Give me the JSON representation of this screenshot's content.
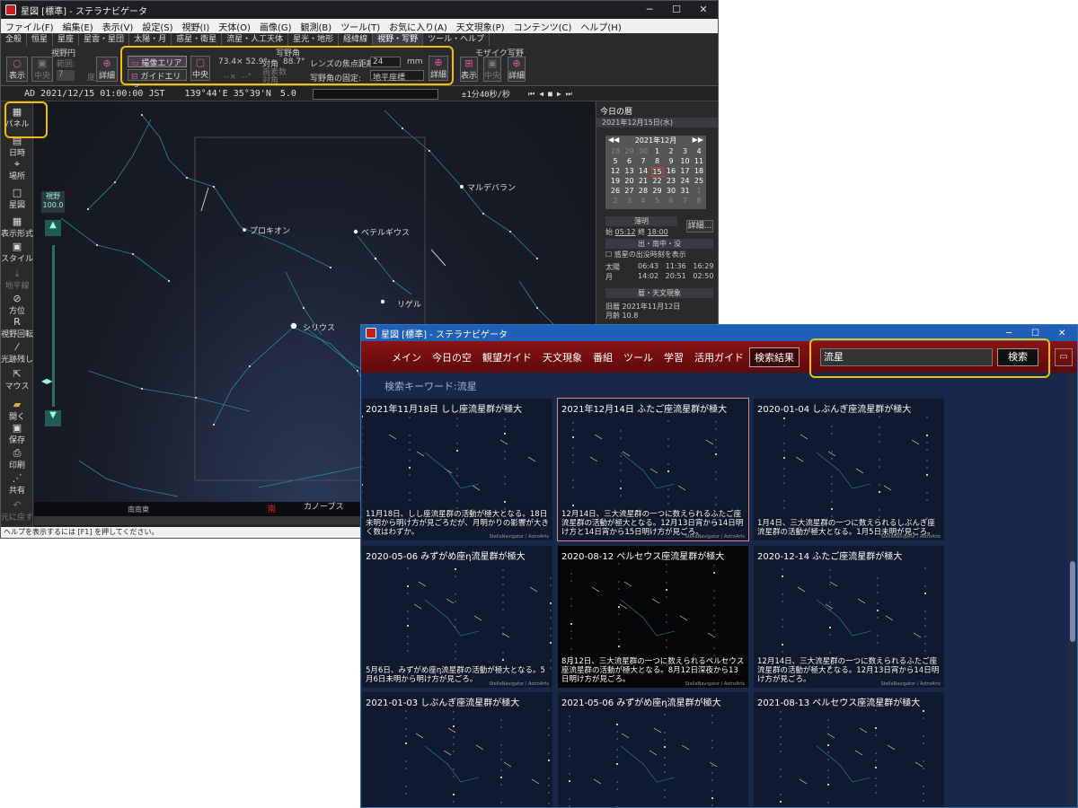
{
  "main": {
    "title": "星図 [標準] - ステラナビゲータ",
    "menu": [
      "ファイル(F)",
      "編集(E)",
      "表示(V)",
      "設定(S)",
      "視野(I)",
      "天体(O)",
      "画像(G)",
      "観測(B)",
      "ツール(T)",
      "お気に入り(A)",
      "天文現象(P)",
      "コンテンツ(C)",
      "ヘルプ(H)"
    ],
    "ribbon_tabs": [
      "全般",
      "恒星",
      "星座",
      "星雲・星団",
      "太陽・月",
      "惑星・衛星",
      "流星・人工天体",
      "星光・地形",
      "経緯線",
      "視野・写野",
      "ツール・ヘルプ"
    ],
    "ribbon": {
      "fov_group": "視野円",
      "fov_range": "範囲:",
      "fov_value": "7",
      "fov_unit": "度",
      "show": "表示",
      "center": "中央",
      "detail": "詳細",
      "photo_group": "写野角",
      "imaging_area": "撮像エリア",
      "guide_area": "ガイドエリア",
      "center2": "中央",
      "angles": "73.4× 52.9°",
      "diag_label": "対角",
      "diag_value": "88.7°",
      "dash": "--×",
      "angles2": "--°",
      "pixels_label": "画素数",
      "diag2": "対角",
      "focal_label": "レンズの焦点距離:",
      "focal_value": "24",
      "focal_unit": "mm",
      "fix_label": "写野角の固定:",
      "fix_value": "地平座標",
      "detail2": "詳細",
      "mosaic_group": "モザイク写野",
      "show2": "表示",
      "center3": "中央",
      "detail3": "詳細"
    },
    "timebar": {
      "ad": "AD",
      "date": "2021/12/15 01:00:00 JST",
      "lon": "139°44'E",
      "lat": "35°39'N",
      "mag": "5.0",
      "step": "±1分40秒/秒"
    },
    "left_tools": [
      "パネル",
      "日時",
      "場所",
      "星図",
      "表示形式",
      "スタイル",
      "地平線",
      "方位",
      "視野回転",
      "光跡残し",
      "マウス",
      "開く",
      "保存",
      "印刷",
      "共有",
      "元に戻す"
    ],
    "fov_label": "視野",
    "fov_num": "100.0",
    "sky_labels": {
      "aldebaran": "マルデバラン",
      "procyon": "プロキオン",
      "betelgeuse": "ベテルギウス",
      "rigel": "リゲル",
      "sirius": "シリウス",
      "canopus": "カノープス",
      "sse": "南南東",
      "south": "南"
    },
    "panel": {
      "header": "今日の暦",
      "date": "2021年12月15日(水)",
      "month": "2021年12月",
      "weekdays": [],
      "calendar": [
        [
          "28",
          "29",
          "30",
          "1",
          "2",
          "3",
          "4"
        ],
        [
          "5",
          "6",
          "7",
          "8",
          "9",
          "10",
          "11"
        ],
        [
          "12",
          "13",
          "14",
          "15",
          "16",
          "17",
          "18"
        ],
        [
          "19",
          "20",
          "21",
          "22",
          "23",
          "24",
          "25"
        ],
        [
          "26",
          "27",
          "28",
          "29",
          "30",
          "31",
          "1"
        ],
        [
          "2",
          "3",
          "4",
          "5",
          "6",
          "7",
          "8"
        ]
      ],
      "twilight": "薄明",
      "start": "始",
      "start_time": "05:12",
      "end": "終",
      "end_time": "18:00",
      "detail": "詳細...",
      "rise_header": "出・南中・没",
      "planet_check": "惑星の出没時刻を表示",
      "sun": "太陽",
      "sun_times": "06:43   11:36   16:29",
      "moon": "月",
      "moon_times": "14:02   20:51   02:50",
      "calendar_header": "暦・天文現象",
      "old_cal": "旧暦",
      "old_cal_value": "2021年11月12日",
      "moon_age": "月齢",
      "moon_age_value": "10.8"
    },
    "status": "ヘルプを表示するには [F1] を押してください。"
  },
  "search": {
    "title": "星図 [標準] - ステラナビゲータ",
    "nav": [
      "メイン",
      "今日の空",
      "観望ガイド",
      "天文現象",
      "番組",
      "ツール",
      "学習",
      "活用ガイド",
      "検索結果"
    ],
    "query": "流星",
    "button": "検索",
    "keyword": "検索キーワード:流星",
    "cards": [
      {
        "title": "2021年11月18日 しし座流星群が極大",
        "desc": "11月18日、しし座流星群の活動が極大となる。18日未明から明け方が見ごろだが、月明かりの影響が大きく数はわずか。",
        "credit": "StellaNavigator / AstroArts"
      },
      {
        "title": "2021年12月14日 ふたご座流星群が極大",
        "desc": "12月14日、三大流星群の一つに数えられるふたご座流星群の活動が極大となる。12月13日宵から14日明け方と14日宵から15日明け方が見ごろ。",
        "credit": "StellaNavigator / AstroArts"
      },
      {
        "title": "2020-01-04 しぶんぎ座流星群が極大",
        "desc": "1月4日、三大流星群の一つに数えられるしぶんぎ座流星群の活動が極大となる。1月5日未明が見ごろ。",
        "credit": "StellaNavigator / AstroArts"
      },
      {
        "title": "2020-05-06 みずがめ座η流星群が極大",
        "desc": "5月6日、みずがめ座η流星群の活動が極大となる。5月6日未明から明け方が見ごろ。",
        "credit": "StellaNavigator / AstroArts"
      },
      {
        "title": "2020-08-12 ペルセウス座流星群が極大",
        "desc": "8月12日、三大流星群の一つに数えられるペルセウス座流星群の活動が極大となる。8月12日深夜から13日明け方が見ごろ。",
        "credit": "StellaNavigator / AstroArts"
      },
      {
        "title": "2020-12-14 ふたご座流星群が極大",
        "desc": "12月14日、三大流星群の一つに数えられるふたご座流星群の活動が極大となる。12月13日宵から14日明け方が見ごろ。",
        "credit": "StellaNavigator / AstroArts"
      },
      {
        "title": "2021-01-03 しぶんぎ座流星群が極大",
        "desc": "",
        "credit": ""
      },
      {
        "title": "2021-05-06 みずがめ座η流星群が極大",
        "desc": "",
        "credit": ""
      },
      {
        "title": "2021-08-13 ペルセウス座流星群が極大",
        "desc": "",
        "credit": ""
      }
    ]
  },
  "colors": {
    "accent": "#f0c000",
    "nav_red": "#7a1010",
    "title_blue": "#1f5fb5"
  }
}
